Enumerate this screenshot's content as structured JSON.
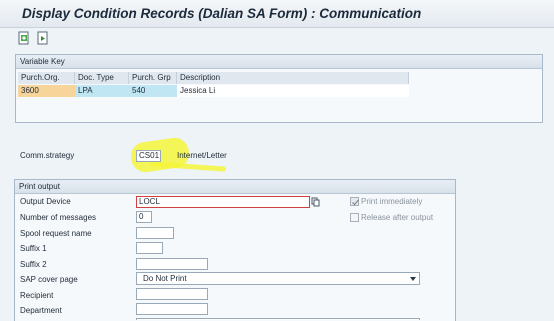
{
  "window": {
    "title": "Display Condition Records (Dalian SA Form) : Communication"
  },
  "toolbar": {
    "icons": [
      "record-overview-icon",
      "communication-icon"
    ]
  },
  "variable_key": {
    "title": "Variable Key",
    "columns": [
      "Purch.Org.",
      "Doc. Type",
      "Purch. Grp",
      "Description"
    ],
    "row": [
      "3600",
      "LPA",
      "540",
      "Jessica Li"
    ]
  },
  "comm": {
    "label": "Comm.strategy",
    "value": "CS01",
    "description": "Internet/Letter"
  },
  "print_output": {
    "title": "Print output",
    "output_device_label": "Output Device",
    "output_device_value": "LOCL",
    "num_messages_label": "Number of messages",
    "num_messages_value": "0",
    "spool_label": "Spool request name",
    "suffix1_label": "Suffix 1",
    "suffix2_label": "Suffix 2",
    "cover_label": "SAP cover page",
    "cover_value": "Do Not Print",
    "recipient_label": "Recipient",
    "department_label": "Department",
    "print_immediately_label": "Print immediately",
    "print_immediately_checked": true,
    "release_after_output_label": "Release after output",
    "release_after_output_checked": false
  },
  "colors": {
    "highlight": "#f5f53a",
    "purch_org_cell": "#f7d49a",
    "doc_cells": "#bfe6f2",
    "accent_red": "#d04040"
  }
}
